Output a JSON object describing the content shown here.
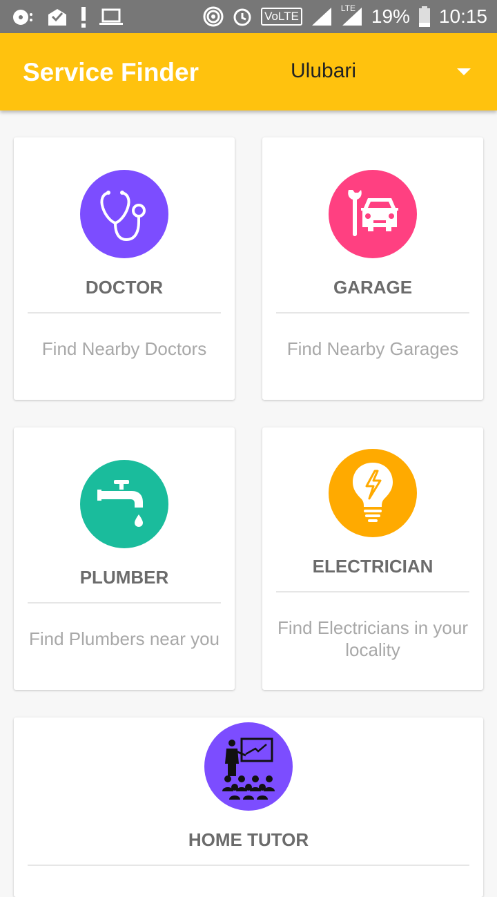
{
  "status_bar": {
    "battery": "19%",
    "time": "10:15",
    "volte_label": "VoLTE",
    "lte_label": "LTE"
  },
  "app_bar": {
    "title": "Service Finder",
    "location": "Ulubari"
  },
  "colors": {
    "app_bar": "#ffc20e",
    "doctor": "#7c4dff",
    "garage": "#ff4081",
    "plumber": "#1abc9c",
    "electrician": "#ffaa00",
    "home_tutor": "#7c4dff"
  },
  "services": [
    {
      "title": "DOCTOR",
      "description": "Find Nearby Doctors",
      "icon": "stethoscope-icon"
    },
    {
      "title": "GARAGE",
      "description": "Find Nearby Garages",
      "icon": "car-wrench-icon"
    },
    {
      "title": "PLUMBER",
      "description": "Find Plumbers near you",
      "icon": "faucet-icon"
    },
    {
      "title": "ELECTRICIAN",
      "description": "Find Electricians in your locality",
      "icon": "lightbulb-icon"
    },
    {
      "title": "HOME TUTOR",
      "description": "",
      "icon": "teacher-icon"
    }
  ]
}
